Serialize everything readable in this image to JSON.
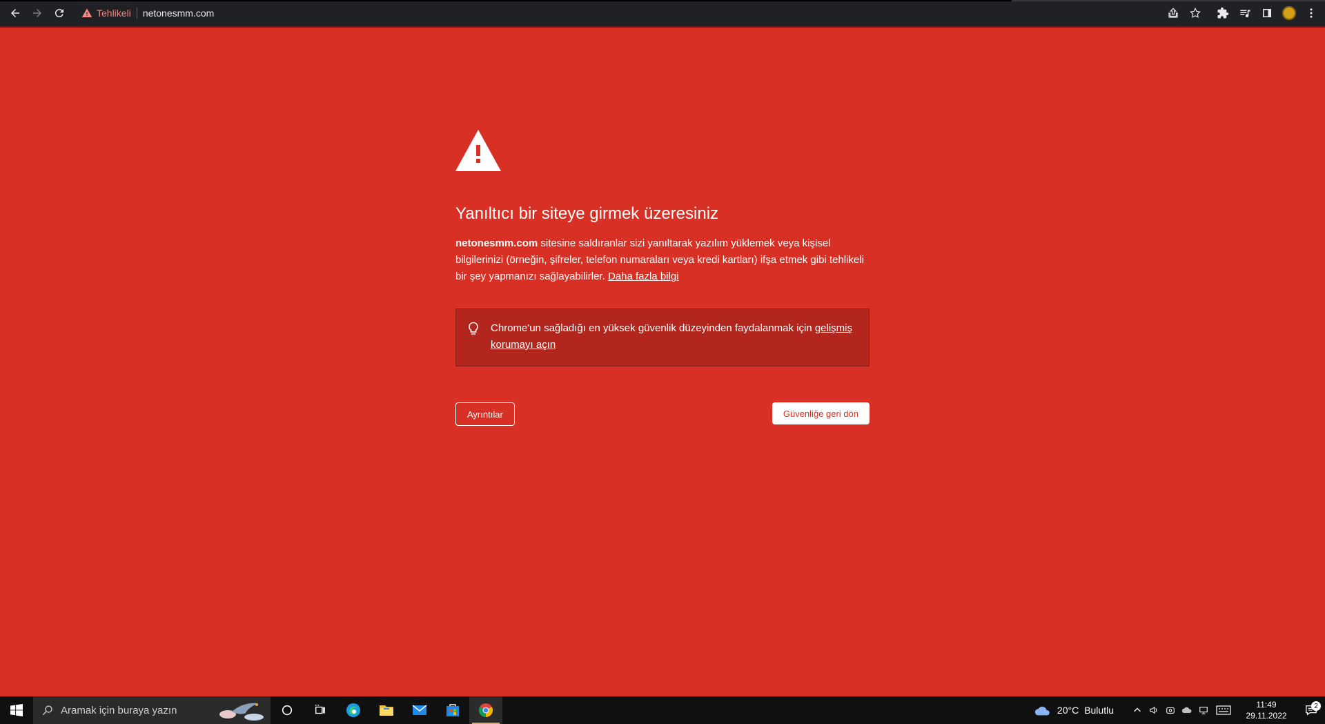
{
  "browser": {
    "security_label": "Tehlikeli",
    "url": "netonesmm.com"
  },
  "interstitial": {
    "headline": "Yanıltıcı bir siteye girmek üzeresiniz",
    "site_name": "netonesmm.com",
    "body_text": " sitesine saldıranlar sizi yanıltarak yazılım yüklemek veya kişisel bilgilerinizi (örneğin, şifreler, telefon numaraları veya kredi kartları) ifşa etmek gibi tehlikeli bir şey yapmanızı sağlayabilirler. ",
    "learn_more_link": "Daha fazla bilgi",
    "promo_text": "Chrome'un sağladığı en yüksek güvenlik düzeyinden faydalanmak için ",
    "promo_link": "gelişmiş korumayı açın",
    "details_button": "Ayrıntılar",
    "back_button": "Güvenliğe geri dön"
  },
  "taskbar": {
    "search_placeholder": "Aramak için buraya yazın",
    "weather_temp": "20°C",
    "weather_desc": "Bulutlu",
    "time": "11:49",
    "date": "29.11.2022",
    "notification_count": "2"
  },
  "colors": {
    "danger_red": "#d93025",
    "promo_red": "#b3261e",
    "toolbar_dark": "#202124"
  }
}
